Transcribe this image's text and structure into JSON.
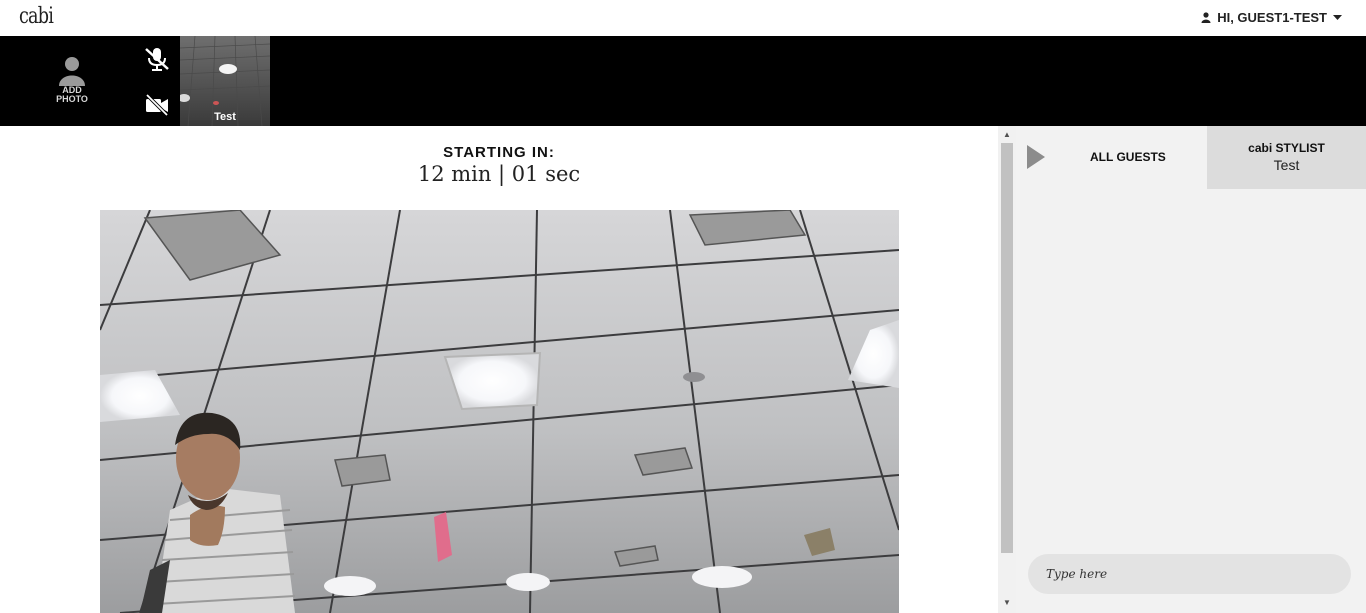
{
  "header": {
    "logo_text": "cabi",
    "user_greeting": "HI, GUEST1-TEST"
  },
  "video_bar": {
    "add_photo_line1": "ADD",
    "add_photo_line2": "PHOTO",
    "mic_icon": "mic-muted-icon",
    "camera_icon": "camera-off-icon",
    "participant_name": "Test"
  },
  "main": {
    "starting_label": "STARTING IN:",
    "countdown": "12 min | 01 sec"
  },
  "chat_panel": {
    "tab_all_guests": "ALL GUESTS",
    "tab_stylist_title": "cabi STYLIST",
    "tab_stylist_name": "Test",
    "input_placeholder": "Type here"
  },
  "colors": {
    "video_bar_bg": "#000000",
    "panel_bg": "#f2f2f2",
    "active_tab_bg": "#dcdcdc",
    "input_bg": "#e3e3e3"
  }
}
